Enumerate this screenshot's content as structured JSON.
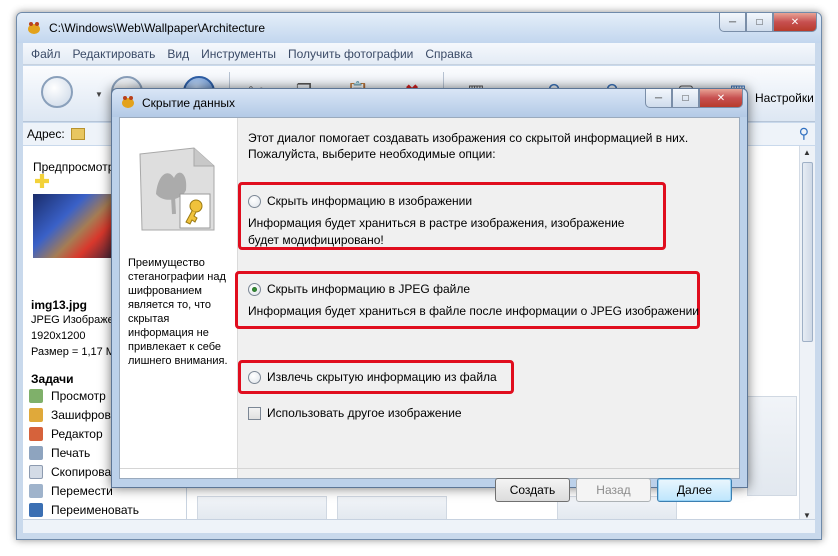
{
  "main_window": {
    "title": "C:\\Windows\\Web\\Wallpaper\\Architecture",
    "menu": [
      "Файл",
      "Редактировать",
      "Вид",
      "Инструменты",
      "Получить фотографии",
      "Справка"
    ],
    "toolbar": {
      "settings_label": "Настройки"
    },
    "address": {
      "label": "Адрес:"
    }
  },
  "left_pane": {
    "preview_title": "Предпросмотр",
    "file": {
      "name": "img13.jpg",
      "type": "JPEG Изображен",
      "dimensions": "1920x1200",
      "size": "Размер = 1,17 М"
    },
    "tasks_title": "Задачи",
    "tasks": [
      {
        "label": "Просмотр",
        "icon": "view-icon"
      },
      {
        "label": "Зашифрова",
        "icon": "lock-icon"
      },
      {
        "label": "Редактор",
        "icon": "pencil-icon"
      },
      {
        "label": "Печать",
        "icon": "printer-icon"
      },
      {
        "label": "Скопирова",
        "icon": "copy-icon"
      },
      {
        "label": "Перемести",
        "icon": "scissors-icon"
      },
      {
        "label": "Переименовать",
        "icon": "rename-icon"
      }
    ]
  },
  "dialog": {
    "title": "Скрытие данных",
    "hint": "Преимущество стеганографии над шифрованием является то, что скрытая информация не привлекает к себе лишнего внимания.",
    "intro": "Этот диалог помогает создавать изображения со скрытой информацией в них. Пожалуйста, выберите необходимые опции:",
    "options": [
      {
        "label": "Скрыть информацию в изображении",
        "checked": false,
        "description": "Информация будет храниться в растре изображения, изображение будет модифицировано!"
      },
      {
        "label": "Скрыть информацию в JPEG файле",
        "checked": true,
        "description": "Информация будет храниться в файле после информации о JPEG изображении"
      },
      {
        "label": "Извлечь скрытую информацию из файла",
        "checked": false
      }
    ],
    "checkbox": {
      "label": "Использовать другое изображение",
      "checked": false
    },
    "buttons": {
      "create": "Создать",
      "back": "Назад",
      "next": "Далее"
    }
  },
  "colors": {
    "highlight_box": "#e00d1e",
    "window_frame": "#c9d9ec"
  }
}
